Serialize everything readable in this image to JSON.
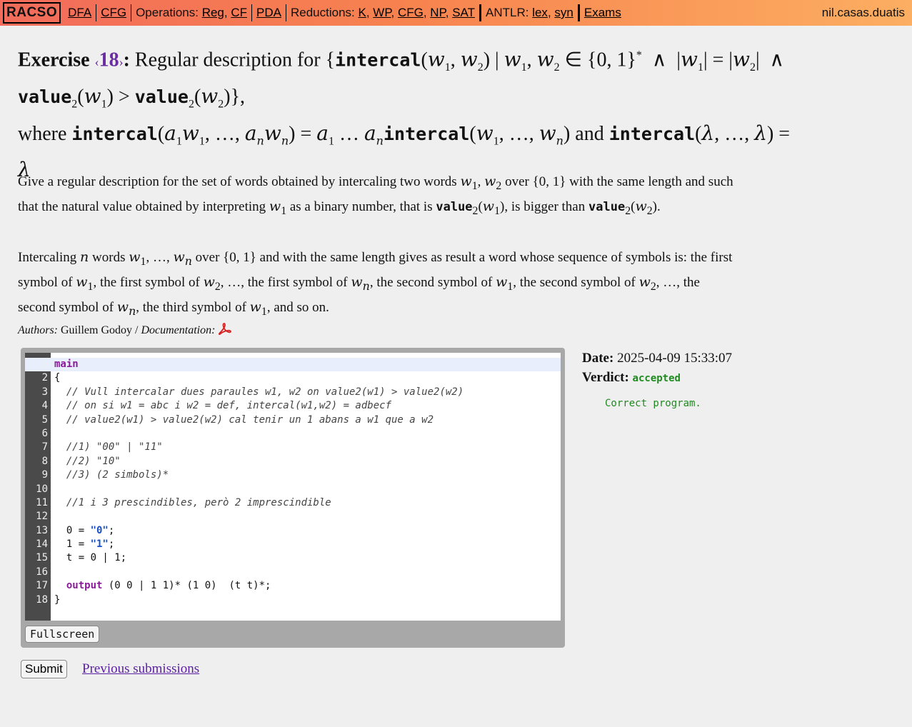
{
  "nav": {
    "brand": "RACSO",
    "dfa": "DFA",
    "cfg": "CFG",
    "ops_label": "Operations:",
    "ops_reg": "Reg",
    "ops_cf": "CF",
    "pda": "PDA",
    "red_label": "Reductions:",
    "red_k": "K",
    "red_wp": "WP",
    "red_cfg": "CFG",
    "red_np": "NP",
    "red_sat": "SAT",
    "antlr_label": "ANTLR:",
    "antlr_lex": "lex",
    "antlr_syn": "syn",
    "exams": "Exams",
    "user": "nil.casas.duatis"
  },
  "exercise": {
    "label": "Exercise",
    "number": "18",
    "title_text": "Regular description for"
  },
  "description": {
    "p1_a": "Give a regular description for the set of words obtained by intercaling two words",
    "p1_b": "over",
    "p1_c": "with the same length and such that the natural value obtained by interpreting",
    "p1_d": "as a binary number, that is",
    "p1_e": ", is bigger than",
    "p2_a": "Intercaling",
    "p2_b": "words",
    "p2_c": "over",
    "p2_d": "and with the same length gives as result a word whose sequence of symbols is: the first symbol of",
    "p2_e": ", the first symbol of",
    "p2_f": ", …, the first symbol of",
    "p2_g": ", the second symbol of",
    "p2_h": ", the second symbol of",
    "p2_i": ", …, the second symbol of",
    "p2_j": ", the third symbol of",
    "p2_k": ", and so on."
  },
  "authors": {
    "label": "Authors:",
    "names": "Guillem Godoy",
    "doc_label": "Documentation:"
  },
  "editor": {
    "lines": [
      "main",
      "{",
      "  // Vull intercalar dues paraules w1, w2 on value2(w1) > value2(w2)",
      "  // on si w1 = abc i w2 = def, intercal(w1,w2) = adbecf",
      "  // value2(w1) > value2(w2) cal tenir un 1 abans a w1 que a w2",
      "",
      "  //1) \"00\" | \"11\"",
      "  //2) \"10\"",
      "  //3) (2 simbols)*",
      "",
      "  //1 i 3 prescindibles, però 2 imprescindible",
      "",
      "  0 = \"0\";",
      "  1 = \"1\";",
      "  t = 0 | 1;",
      "",
      "  output (0 0 | 1 1)* (1 0)  (t t)*;",
      "}"
    ],
    "fullscreen": "Fullscreen"
  },
  "actions": {
    "submit": "Submit",
    "previous": "Previous submissions"
  },
  "result": {
    "date_label": "Date:",
    "date_value": "2025-04-09 15:33:07",
    "verdict_label": "Verdict:",
    "verdict_value": "accepted",
    "message": "Correct program."
  }
}
